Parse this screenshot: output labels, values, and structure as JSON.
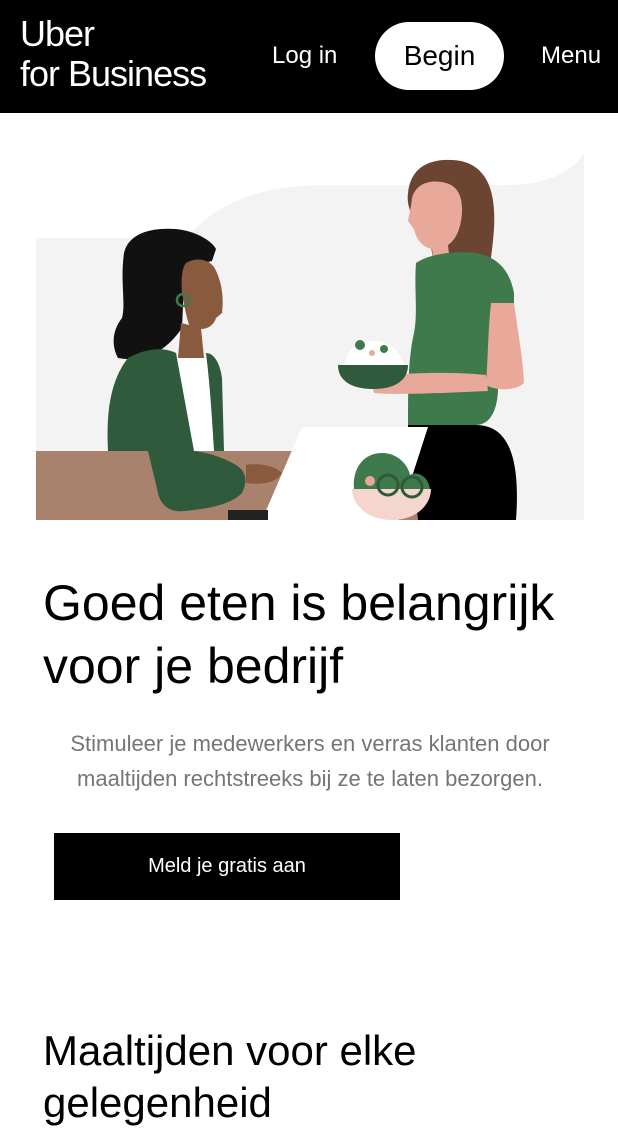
{
  "header": {
    "logo_line1": "Uber",
    "logo_line2": "for Business",
    "login_label": "Log in",
    "begin_label": "Begin",
    "menu_label": "Menu"
  },
  "hero": {
    "title_line1": "Goed eten is belangrijk",
    "title_line2": "voor je bedrijf",
    "subtitle_line1": "Stimuleer je medewerkers en verras klanten door",
    "subtitle_line2": "maaltijden rechtstreeks bij ze te laten bezorgen.",
    "cta_label": "Meld je gratis aan"
  },
  "section": {
    "title": "Maaltijden voor elke gelegenheid"
  },
  "colors": {
    "header_bg": "#000000",
    "accent_green": "#2F5A3B",
    "shirt_green": "#3E7A4C",
    "skin_dark": "#8A5A3E",
    "skin_light": "#E8A89A",
    "table_brown": "#A8826C",
    "bg_gray": "#F3F3F3"
  },
  "icons": [
    "hero-illustration"
  ]
}
